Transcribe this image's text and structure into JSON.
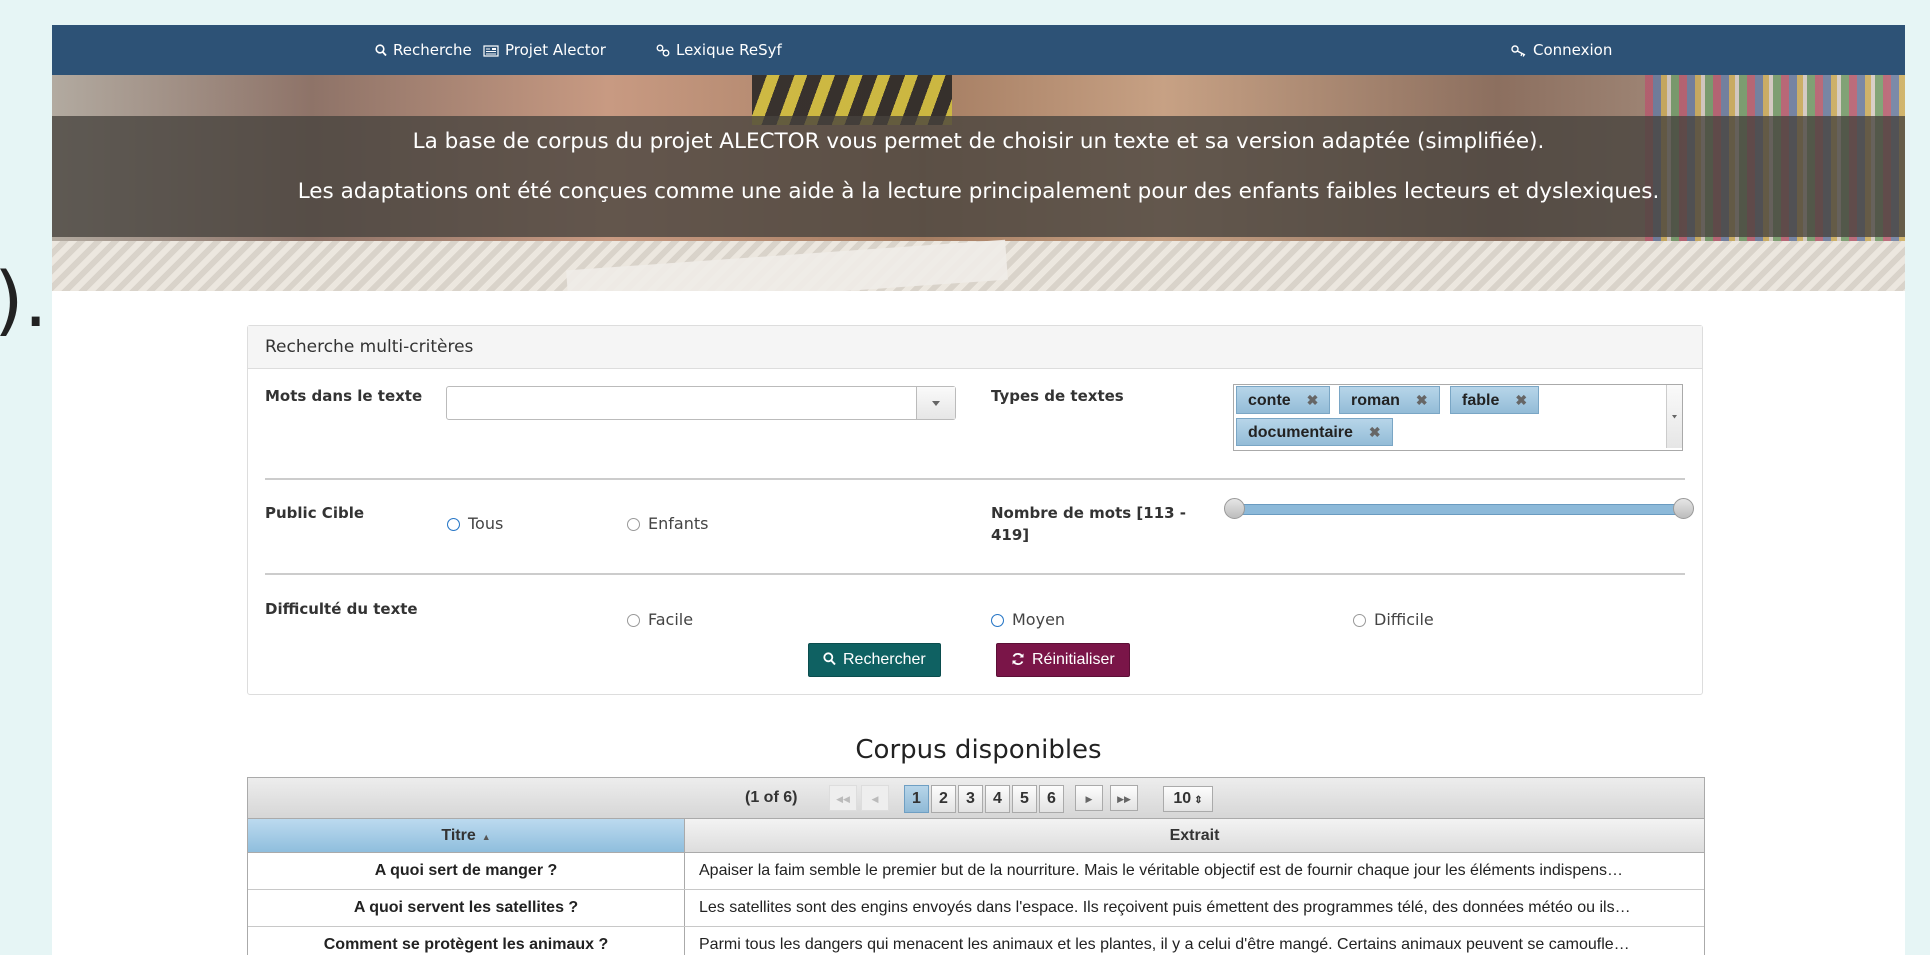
{
  "edge_text": ").",
  "nav": {
    "search": "Recherche",
    "project": "Projet Alector",
    "lexicon": "Lexique ReSyf",
    "login": "Connexion"
  },
  "hero": {
    "line1": "La base de corpus du projet ALECTOR vous permet de choisir un texte et sa version adaptée (simplifiée).",
    "line2": "Les adaptations ont été conçues comme une aide à la lecture principalement pour des enfants faibles lecteurs et dyslexiques."
  },
  "search_panel": {
    "title": "Recherche multi-critères",
    "words_label": "Mots dans le texte",
    "words_value": "",
    "types_label": "Types de textes",
    "types": [
      "conte",
      "roman",
      "fable",
      "documentaire"
    ],
    "public_label": "Public Cible",
    "public_options": [
      "Tous",
      "Enfants"
    ],
    "public_selected": "Tous",
    "word_count_label_1": "Nombre de mots [113 -",
    "word_count_label_2": "419]",
    "word_count_min": 113,
    "word_count_max": 419,
    "difficulty_label": "Difficulté du texte",
    "difficulty_options": [
      "Facile",
      "Moyen",
      "Difficile"
    ],
    "difficulty_selected": "Moyen",
    "search_button": "Rechercher",
    "reset_button": "Réinitialiser"
  },
  "corpus": {
    "title": "Corpus disponibles",
    "page_info": "(1 of 6)",
    "pages": [
      "1",
      "2",
      "3",
      "4",
      "5",
      "6"
    ],
    "current_page": "1",
    "rows_per_page": "10",
    "columns": [
      "Titre",
      "Extrait"
    ],
    "rows": [
      {
        "title": "A quoi sert de manger ?",
        "extract": "Apaiser la faim semble le premier but de la nourriture. Mais le véritable objectif est de fournir chaque jour les éléments indispens…"
      },
      {
        "title": "A quoi servent les satellites ?",
        "extract": "Les satellites sont des engins envoyés dans l'espace. Ils reçoivent puis émettent des programmes télé, des données météo ou ils…"
      },
      {
        "title": "Comment se protègent les animaux ?",
        "extract": "Parmi tous les dangers qui menacent les animaux et les plantes, il y a celui d'être mangé. Certains animaux peuvent se camoufle…"
      }
    ]
  },
  "colors": {
    "nav_bg": "#2d5276",
    "search_button": "#0f6162",
    "reset_button": "#7a1548",
    "accent_blue": "#8fbedd"
  },
  "icons": {
    "search": "magnifier-icon",
    "project": "newspaper-icon",
    "lexicon": "link-icon",
    "login": "key-icon",
    "reset": "refresh-icon"
  }
}
